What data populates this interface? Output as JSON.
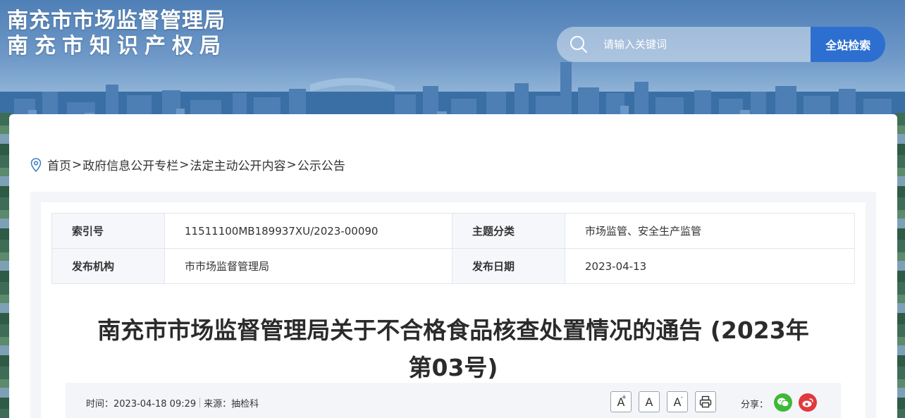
{
  "header": {
    "title_line1": "南充市市场监督管理局",
    "title_line2": "南充市知识产权局"
  },
  "search": {
    "placeholder": "请输入关键词",
    "button_label": "全站检索"
  },
  "breadcrumb": {
    "items": [
      "首页",
      "政府信息公开专栏",
      "法定主动公开内容",
      "公示公告"
    ],
    "separator": ">"
  },
  "meta": {
    "index_label": "索引号",
    "index_value": "11511100MB189937XU/2023-00090",
    "topic_label": "主题分类",
    "topic_value": "市场监管、安全生产监管",
    "publisher_label": "发布机构",
    "publisher_value": "市市场监督管理局",
    "date_label": "发布日期",
    "date_value": "2023-04-13"
  },
  "article": {
    "title_line1": "南充市市场监督管理局关于不合格食品核查处置情况的通告 (2023年",
    "title_line2": "第03号)",
    "time_text": "时间：2023-04-18 09:29",
    "source_text": "来源：抽检科"
  },
  "tools": {
    "font_larger": "A",
    "font_normal": "A",
    "font_smaller": "A",
    "share_label": "分享："
  },
  "icons": {
    "search": "search-icon",
    "location": "location-pin-icon",
    "print": "print-icon",
    "wechat": "wechat-icon",
    "weibo": "weibo-icon"
  },
  "colors": {
    "search_button": "#2d6fd0",
    "wechat": "#3fb837",
    "weibo": "#e0393e"
  }
}
